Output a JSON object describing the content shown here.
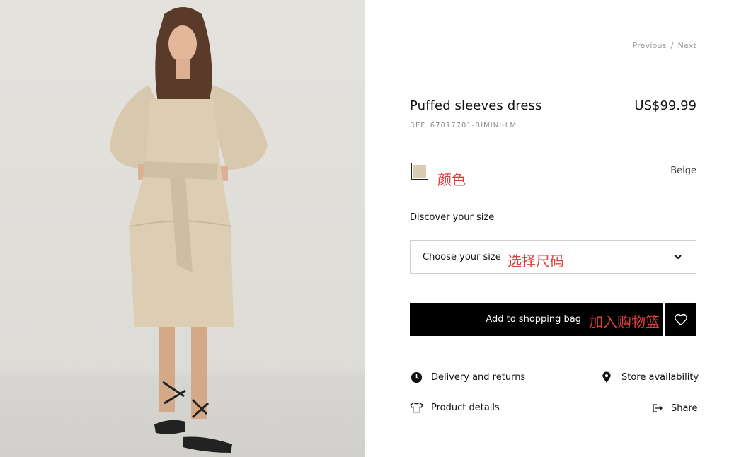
{
  "pager": {
    "previous": "Previous",
    "separator": "/",
    "next": "Next"
  },
  "product": {
    "title": "Puffed sleeves dress",
    "price": "US$99.99",
    "ref": "REF. 67017701-RIMINI-LM"
  },
  "color": {
    "swatch_hex": "#d9ccb3",
    "annotation": "颜色",
    "name": "Beige"
  },
  "size": {
    "discover_link": "Discover your size",
    "select_label": "Choose your size",
    "annotation": "选择尺码"
  },
  "cart": {
    "add_label": "Add to shopping bag",
    "annotation": "加入购物篮"
  },
  "links": {
    "delivery": "Delivery and returns",
    "store": "Store availability",
    "details": "Product details",
    "share": "Share"
  },
  "colors": {
    "annotation_red": "#e23b3b",
    "button_black": "#000000"
  }
}
